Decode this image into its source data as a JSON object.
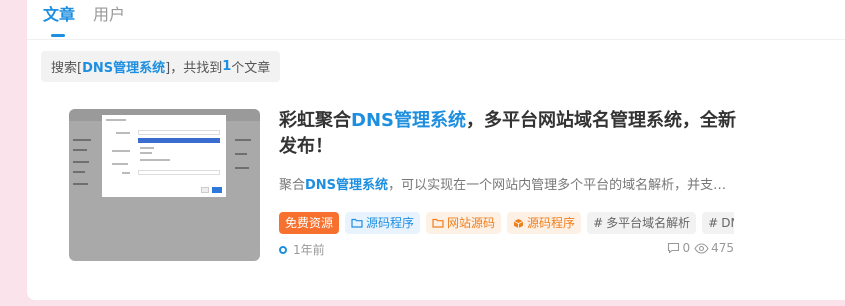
{
  "tabs": [
    {
      "label": "文章",
      "active": true
    },
    {
      "label": "用户",
      "active": false
    }
  ],
  "search_summary": {
    "prefix": "搜索[",
    "keyword": "DNS管理系统",
    "middle": "]，共找到",
    "count": "1",
    "suffix": "个文章"
  },
  "article": {
    "title_before": "彩虹聚合",
    "title_highlight": "DNS管理系统",
    "title_after": "，多平台网站域名管理系统，全新发布！",
    "excerpt_before": "聚合",
    "excerpt_highlight": "DNS管理系统",
    "excerpt_after": "，可以实现在一个网站内管理多个平台的域名解析，并支持多用户",
    "tags": [
      {
        "label": "免费资源",
        "style": "free",
        "icon": ""
      },
      {
        "label": "源码程序",
        "style": "blue",
        "icon": "folder-icon"
      },
      {
        "label": "网站源码",
        "style": "orange",
        "icon": "folder-icon"
      },
      {
        "label": "源码程序",
        "style": "orange",
        "icon": "box-icon"
      },
      {
        "label": "多平台域名解析",
        "style": "grey",
        "icon": "hash-icon"
      },
      {
        "label": "DNS管理系统",
        "style": "grey",
        "icon": "hash-icon"
      }
    ],
    "time": "1年前",
    "comments": "0",
    "views": "475"
  },
  "colors": {
    "accent": "#1e8fe0",
    "free_tag": "#f7702d",
    "background": "#fbe3ec"
  }
}
